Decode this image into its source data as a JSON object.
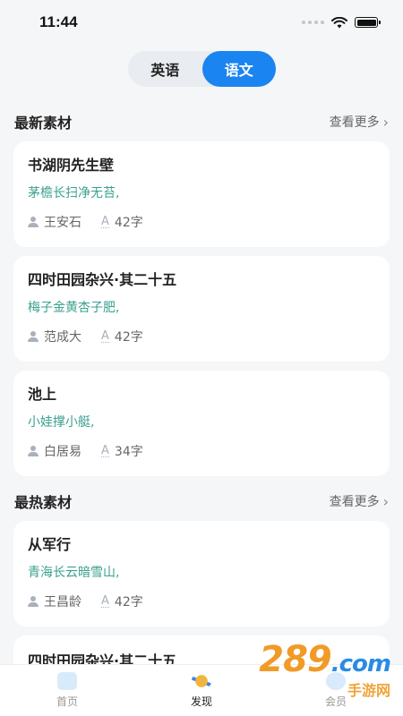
{
  "status": {
    "time": "11:44",
    "wifi_icon": "wifi-icon",
    "battery_icon": "battery-icon"
  },
  "segment": {
    "tabs": [
      {
        "label": "英语",
        "active": false
      },
      {
        "label": "语文",
        "active": true
      }
    ],
    "accent": "#1a84f0"
  },
  "sections": [
    {
      "title": "最新素材",
      "more": "查看更多",
      "cards": [
        {
          "title": "书湖阴先生壁",
          "excerpt": "茅檐长扫净无苔,",
          "author": "王安石",
          "count": "42字"
        },
        {
          "title": "四时田园杂兴·其二十五",
          "excerpt": "梅子金黄杏子肥,",
          "author": "范成大",
          "count": "42字"
        },
        {
          "title": "池上",
          "excerpt": "小娃撑小艇,",
          "author": "白居易",
          "count": "34字"
        }
      ]
    },
    {
      "title": "最热素材",
      "more": "查看更多",
      "cards": [
        {
          "title": "从军行",
          "excerpt": "青海长云暗雪山,",
          "author": "王昌龄",
          "count": "42字"
        },
        {
          "title": "四时田园杂兴·其二十五"
        }
      ]
    }
  ],
  "tabbar": [
    {
      "label": "首页",
      "icon": "home-icon",
      "active": false
    },
    {
      "label": "发现",
      "icon": "discover-icon",
      "active": true
    },
    {
      "label": "会员",
      "icon": "member-icon",
      "active": false
    }
  ],
  "watermark": {
    "number": "289",
    "suffix": ".com",
    "text": "手游网"
  },
  "colors": {
    "excerpt": "#3aa08f",
    "background": "#f5f6f8"
  }
}
